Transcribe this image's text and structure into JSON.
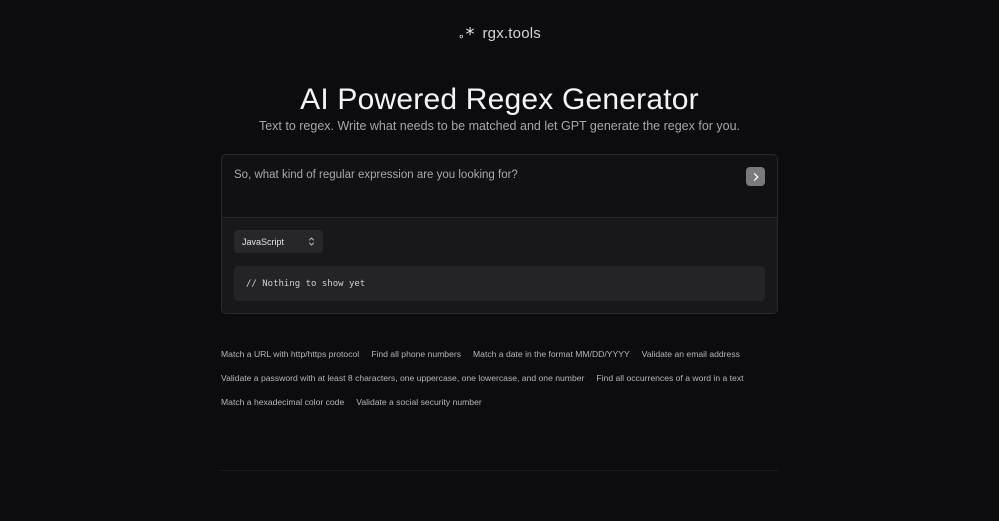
{
  "brand": {
    "logo_dot": "∘",
    "logo_star": "*",
    "name": "rgx.tools"
  },
  "hero": {
    "title": "AI Powered Regex Generator",
    "subtitle": "Text to regex. Write what needs to be matched and let GPT generate the regex for you."
  },
  "prompt": {
    "placeholder": "So, what kind of regular expression are you looking for?",
    "value": ""
  },
  "language_select": {
    "selected": "JavaScript"
  },
  "output": {
    "text": "// Nothing to show yet"
  },
  "examples": [
    [
      "Match a URL with http/https protocol",
      "Find all phone numbers",
      "Match a date in the format MM/DD/YYYY",
      "Validate an email address"
    ],
    [
      "Validate a password with at least 8 characters, one uppercase, one lowercase, and one number",
      "Find all occurrences of a word in a text"
    ],
    [
      "Match a hexadecimal color code",
      "Validate a social security number"
    ]
  ],
  "colors": {
    "background": "#0c0c0e",
    "card": "#131315",
    "send_button": "#7a7a7e"
  }
}
